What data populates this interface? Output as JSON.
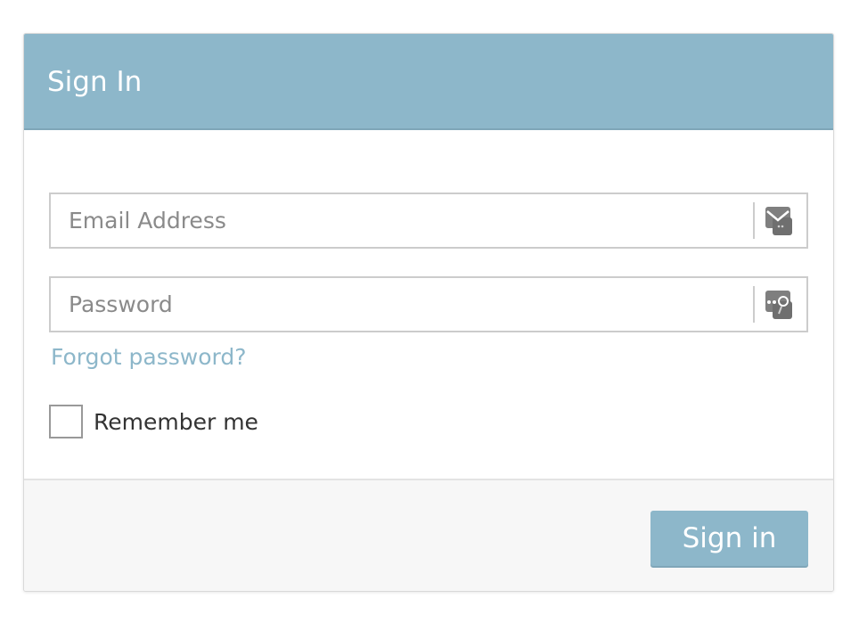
{
  "form": {
    "title": "Sign In",
    "email": {
      "placeholder": "Email Address",
      "value": "",
      "icon": "envelope-icon"
    },
    "password": {
      "placeholder": "Password",
      "value": "",
      "icon": "key-icon"
    },
    "forgot_password": "Forgot password?",
    "remember_me": {
      "label": "Remember me",
      "checked": false
    },
    "submit_label": "Sign in"
  },
  "colors": {
    "accent": "#8db7ca",
    "footer_bg": "#f7f7f7",
    "border": "#cccccc"
  }
}
